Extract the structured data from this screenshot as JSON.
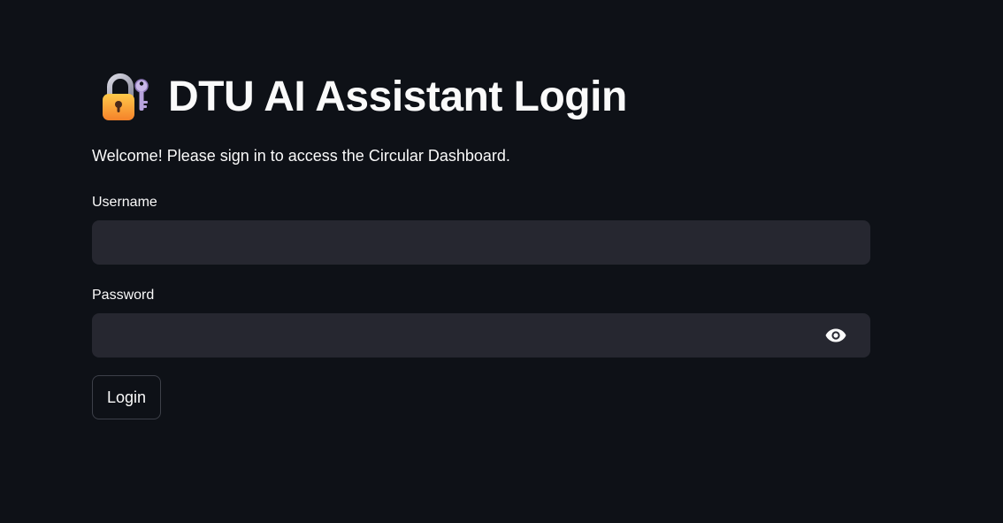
{
  "header": {
    "icon": "lock-with-key-icon",
    "title": "DTU AI Assistant Login"
  },
  "welcome_text": "Welcome! Please sign in to access the Circular Dashboard.",
  "form": {
    "username": {
      "label": "Username",
      "value": "",
      "placeholder": ""
    },
    "password": {
      "label": "Password",
      "value": "",
      "placeholder": "",
      "toggle_icon": "eye-icon"
    },
    "login_button_label": "Login"
  },
  "colors": {
    "background": "#0e1117",
    "input_background": "#262730",
    "text": "#fafafa",
    "button_border": "#3d4049"
  }
}
